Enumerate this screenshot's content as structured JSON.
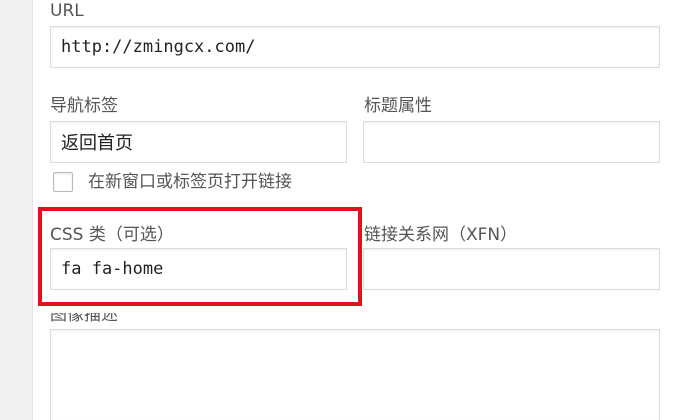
{
  "menu_item": {
    "url": {
      "label": "URL",
      "value": "http://zmingcx.com/"
    },
    "nav_label": {
      "label": "导航标签",
      "value": "返回首页"
    },
    "title_attribute": {
      "label": "标题属性",
      "value": ""
    },
    "open_new_tab": {
      "label": "在新窗口或标签页打开链接",
      "checked": false
    },
    "css_classes": {
      "label": "CSS 类（可选）",
      "value": "fa fa-home"
    },
    "xfn": {
      "label": "链接关系网（XFN）",
      "value": ""
    },
    "description": {
      "label": "图像描述",
      "value": ""
    }
  },
  "colors": {
    "highlight": "#e0121f"
  }
}
